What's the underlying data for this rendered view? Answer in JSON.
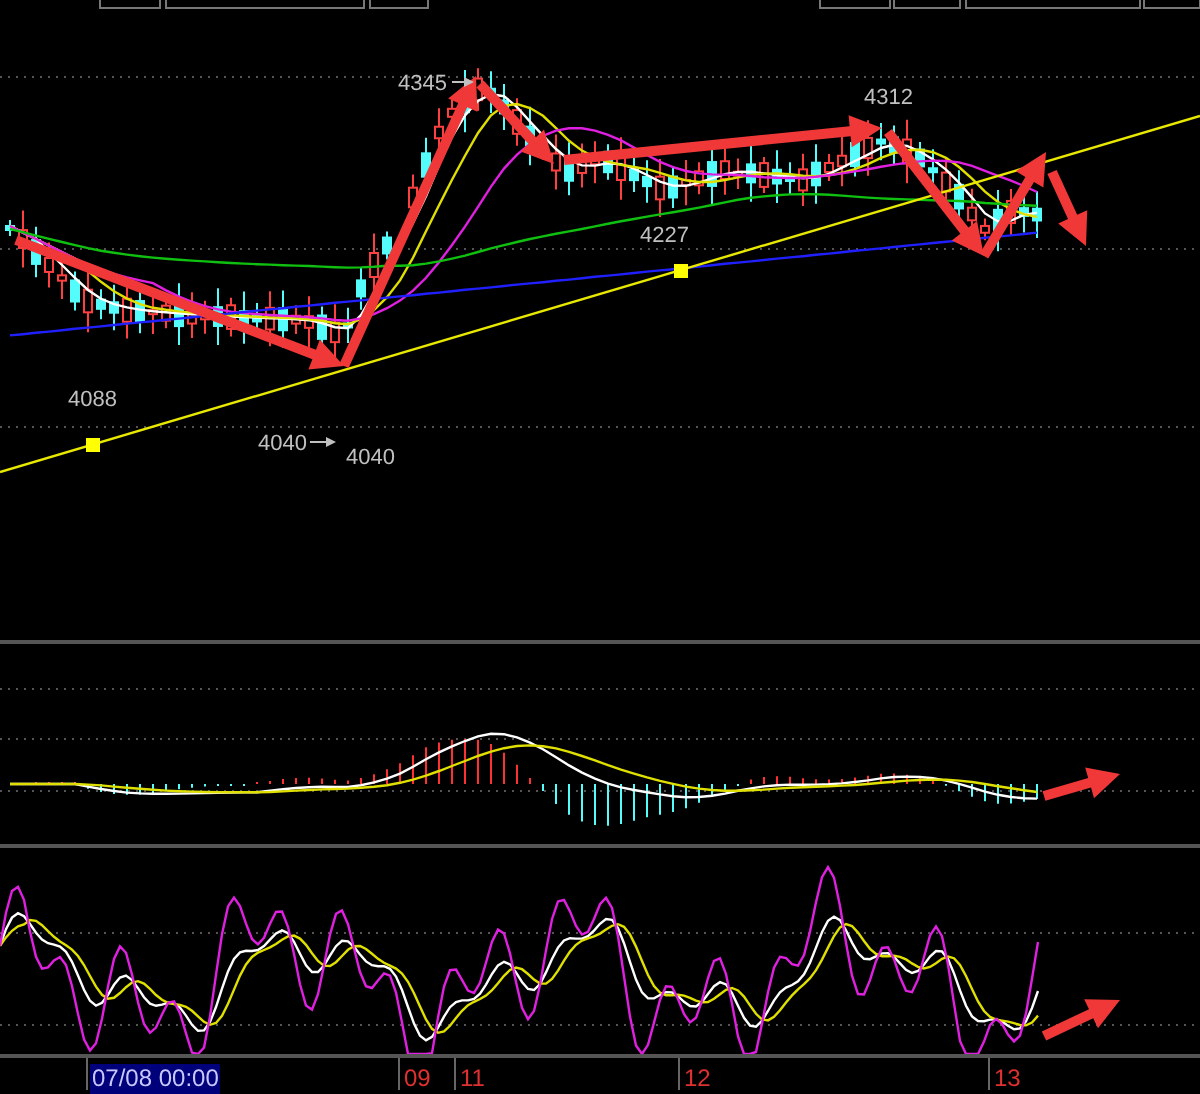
{
  "price_labels": [
    {
      "text": "4345"
    },
    {
      "text": "4312"
    },
    {
      "text": "4227"
    },
    {
      "text": "4088"
    },
    {
      "text": "4040"
    },
    {
      "text": "4040"
    }
  ],
  "time_axis": [
    {
      "label": "07/08 00:00",
      "selected": true
    },
    {
      "label": "09",
      "selected": false
    },
    {
      "label": "11",
      "selected": false
    },
    {
      "label": "12",
      "selected": false
    },
    {
      "label": "13",
      "selected": false
    }
  ]
}
